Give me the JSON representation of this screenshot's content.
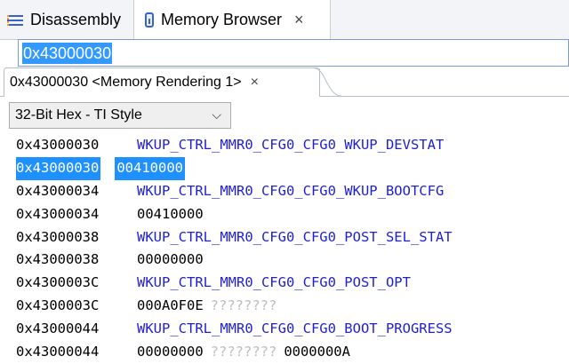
{
  "view_tabs": [
    {
      "label": "Disassembly",
      "icon": "disassembly-icon"
    },
    {
      "label": "Memory Browser",
      "icon": "memory-icon",
      "close": "×"
    }
  ],
  "address_input": {
    "value": "0x43000030"
  },
  "rendering_tab": {
    "label": "0x43000030 <Memory Rendering 1>",
    "close": "×"
  },
  "format_select": {
    "value": "32-Bit Hex - TI Style",
    "chevron": "⌵"
  },
  "rows": [
    {
      "addr": "0x43000030",
      "name": "WKUP_CTRL_MMR0_CFG0_CFG0_WKUP_DEVSTAT"
    },
    {
      "addr": "0x43000030",
      "values": [
        "00410000"
      ],
      "selected": true
    },
    {
      "addr": "0x43000034",
      "name": "WKUP_CTRL_MMR0_CFG0_CFG0_WKUP_BOOTCFG"
    },
    {
      "addr": "0x43000034",
      "values": [
        "00410000"
      ]
    },
    {
      "addr": "0x43000038",
      "name": "WKUP_CTRL_MMR0_CFG0_CFG0_POST_SEL_STAT"
    },
    {
      "addr": "0x43000038",
      "values": [
        "00000000"
      ]
    },
    {
      "addr": "0x4300003C",
      "name": "WKUP_CTRL_MMR0_CFG0_CFG0_POST_OPT"
    },
    {
      "addr": "0x4300003C",
      "values": [
        "000A0F0E",
        "????????"
      ]
    },
    {
      "addr": "0x43000044",
      "name": "WKUP_CTRL_MMR0_CFG0_CFG0_BOOT_PROGRESS"
    },
    {
      "addr": "0x43000044",
      "values": [
        "00000000",
        "????????",
        "0000000A"
      ]
    }
  ],
  "colors": {
    "register_name": "#1f1fd6",
    "selection": "#1e90ff",
    "unknown": "#bdbdbd"
  }
}
